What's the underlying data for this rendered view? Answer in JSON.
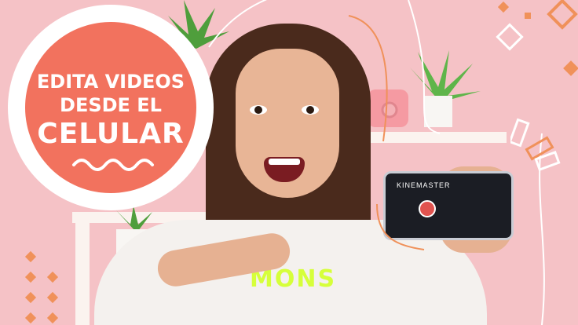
{
  "headline": {
    "line1": "EDITA VIDEOS",
    "line2": "DESDE EL",
    "line3": "CELULAR"
  },
  "phone_app": {
    "name": "KINEMASTER"
  },
  "shirt": {
    "text": "MONS"
  },
  "colors": {
    "background": "#f5c2c6",
    "badge": "#f2725e",
    "accent_orange": "#f0915a",
    "shirt_print": "#d6ff3a"
  }
}
